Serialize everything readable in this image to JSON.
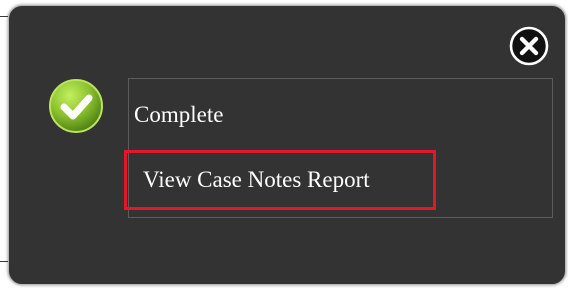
{
  "dialog": {
    "status_text": "Complete",
    "report_link_label": "View Case Notes Report"
  },
  "icons": {
    "close": "close-icon",
    "status": "checkmark-icon"
  },
  "colors": {
    "dialog_background": "#333333",
    "check_green": "#8bc12d",
    "highlight_red": "#e1182a",
    "text": "#ffffff"
  }
}
